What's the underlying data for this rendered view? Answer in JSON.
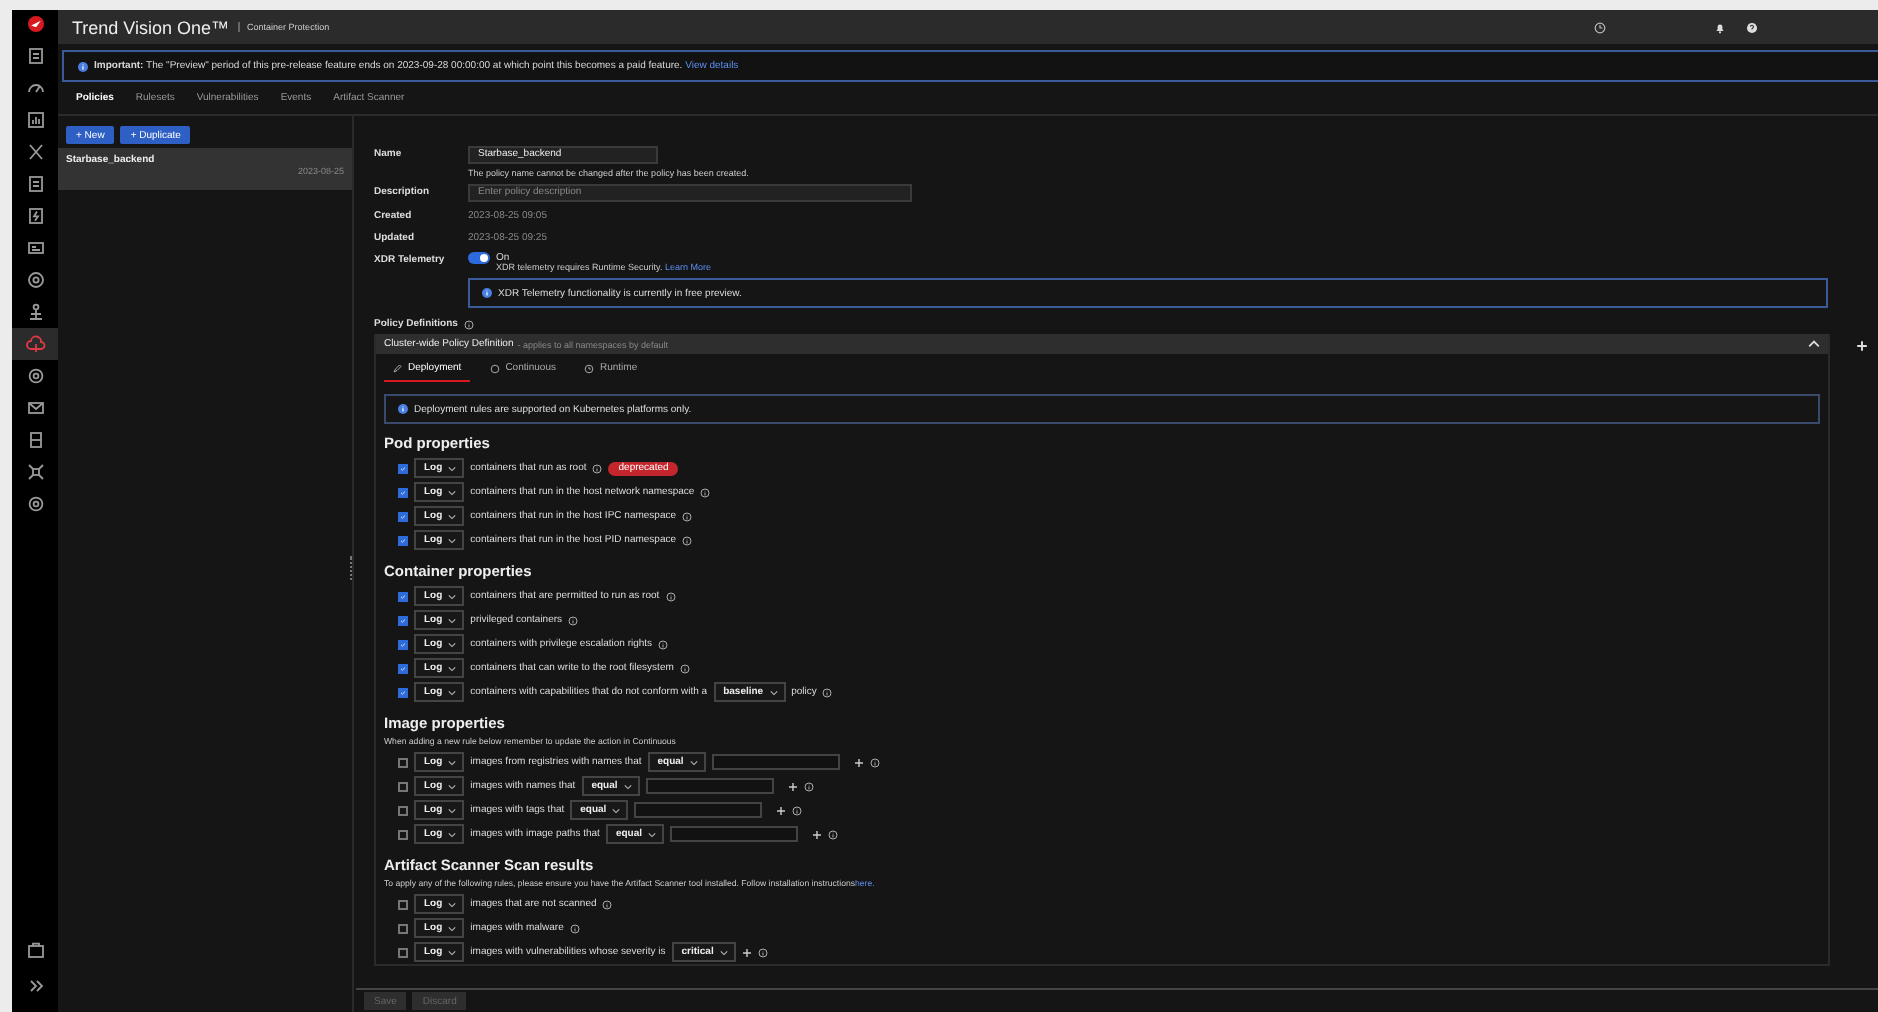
{
  "header": {
    "product": "Trend Vision One™",
    "section": "Container Protection"
  },
  "nav": [
    {
      "selected": false
    },
    {
      "selected": false
    },
    {
      "selected": false
    },
    {
      "selected": false
    },
    {
      "selected": false
    },
    {
      "selected": false
    },
    {
      "selected": false
    },
    {
      "selected": false
    },
    {
      "selected": false
    },
    {
      "selected": true
    },
    {
      "selected": false
    },
    {
      "selected": false
    },
    {
      "selected": false
    },
    {
      "selected": false
    },
    {
      "selected": false
    }
  ],
  "banner": {
    "text": "**Important:** The \"Preview\" period of this pre-release feature ends on 2023-09-28 00:00:00 at which point this becomes a paid feature.",
    "link": "View details"
  },
  "tabs": [
    {
      "label": "Policies",
      "selected": true
    },
    {
      "label": "Rulesets",
      "selected": false
    },
    {
      "label": "Vulnerabilities",
      "selected": false
    },
    {
      "label": "Events",
      "selected": false
    },
    {
      "label": "Artifact Scanner",
      "selected": false
    }
  ],
  "list_actions": [
    "+ New",
    "+ Duplicate"
  ],
  "policies": [
    {
      "name": "Starbase_backend",
      "date": "2023-08-25",
      "selected": true
    }
  ],
  "form": {
    "name_label": "Name",
    "name_value": "Starbase_backend",
    "name_hint": "The policy name cannot be changed after the policy has been created.",
    "description_label": "Description",
    "description_placeholder": "Enter policy description",
    "created_label": "Created",
    "created_value": "2023-08-25 09:05",
    "updated_label": "Updated",
    "updated_value": "2023-08-25 09:25",
    "xdr_label": "XDR Telemetry",
    "xdr_on": true,
    "xdr_state": "On",
    "xdr_hint": "XDR telemetry requires Runtime Security.",
    "xdr_link": "Learn More",
    "xdr_notice": "XDR Telemetry functionality is currently in free preview."
  },
  "policy_definitions": "Policy Definitions",
  "cluster": {
    "title": "Cluster-wide Policy Definition",
    "subtitle": "- applies to all namespaces by default",
    "expanded": true
  },
  "rule_tabs": [
    {
      "label": "Deployment",
      "selected": true
    },
    {
      "label": "Continuous",
      "selected": false
    },
    {
      "label": "Runtime",
      "selected": false
    }
  ],
  "notice": "Deployment rules are supported on Kubernetes platforms only.",
  "sections": [
    {
      "title": "Pod properties",
      "rules": [
        {
          "kind": "plain",
          "checked": true,
          "action": "Log",
          "text": "containers that run as root",
          "badge": "deprecated"
        },
        {
          "kind": "plain",
          "checked": true,
          "action": "Log",
          "text": "containers that run in the host network namespace"
        },
        {
          "kind": "plain",
          "checked": true,
          "action": "Log",
          "text": "containers that run in the host IPC namespace"
        },
        {
          "kind": "plain",
          "checked": true,
          "action": "Log",
          "text": "containers that run in the host PID namespace"
        }
      ]
    },
    {
      "title": "Container properties",
      "rules": [
        {
          "kind": "plain",
          "checked": true,
          "action": "Log",
          "text": "containers that are permitted to run as root"
        },
        {
          "kind": "plain",
          "checked": true,
          "action": "Log",
          "text": "privileged containers"
        },
        {
          "kind": "plain",
          "checked": true,
          "action": "Log",
          "text": "containers with privilege escalation rights"
        },
        {
          "kind": "plain",
          "checked": true,
          "action": "Log",
          "text": "containers that can write to the root filesystem"
        },
        {
          "kind": "select-suffix",
          "checked": true,
          "action": "Log",
          "text": "containers with capabilities that do not conform with a",
          "option": "baseline",
          "suffix": "policy"
        }
      ]
    },
    {
      "title": "Image properties",
      "note": "When adding a new rule below remember to update the action in Continuous",
      "rules": [
        {
          "kind": "match",
          "checked": false,
          "action": "Log",
          "text": "images from registries with names that",
          "option": "equal"
        },
        {
          "kind": "match",
          "checked": false,
          "action": "Log",
          "text": "images with names that",
          "option": "equal"
        },
        {
          "kind": "match",
          "checked": false,
          "action": "Log",
          "text": "images with tags that",
          "option": "equal"
        },
        {
          "kind": "match",
          "checked": false,
          "action": "Log",
          "text": "images with image paths that",
          "option": "equal"
        }
      ]
    },
    {
      "title": "Artifact Scanner Scan results",
      "note": "To apply any of the following rules, please ensure you have the Artifact Scanner tool installed. Follow installation instructions",
      "note_link": "here.",
      "rules": [
        {
          "kind": "plain",
          "checked": false,
          "action": "Log",
          "text": "images that are not scanned"
        },
        {
          "kind": "plain",
          "checked": false,
          "action": "Log",
          "text": "images with malware"
        },
        {
          "kind": "threshold",
          "checked": false,
          "action": "Log",
          "text": "images with vulnerabilities whose severity is",
          "option": "critical"
        }
      ]
    }
  ],
  "footer_buttons": [
    {
      "label": "Save",
      "disabled": true
    },
    {
      "label": "Discard",
      "disabled": true
    }
  ]
}
